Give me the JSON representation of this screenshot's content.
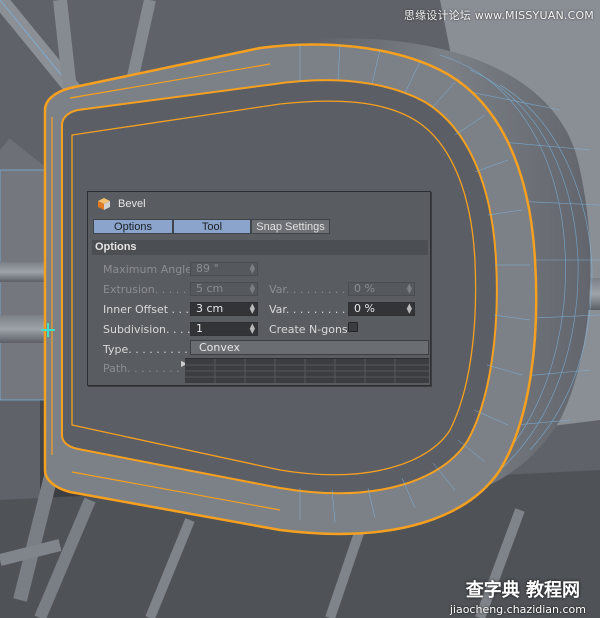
{
  "watermarks": {
    "top": "思缘设计论坛 www.MISSYUAN.COM",
    "bottom_logo": "查字典 教程网",
    "bottom_url": "jiaocheng.chazidian.com"
  },
  "icons": {
    "panel_icon": "bevel-cube-icon",
    "cursor_icon": "crosshair-plus-icon",
    "path_expander_icon": "triangle-right-icon"
  },
  "colors": {
    "highlight_edge": "#f5a021",
    "wireframe": "#7ab8e6",
    "tab_active": "#8aa4cc",
    "cursor": "#3fe0c8"
  },
  "panel": {
    "title": "Bevel",
    "tabs": [
      {
        "label": "Options",
        "active": true
      },
      {
        "label": "Tool",
        "active": true
      },
      {
        "label": "Snap Settings",
        "active": false
      }
    ],
    "section_title": "Options",
    "fields": {
      "maximum_angle": {
        "label": "Maximum Angle",
        "value": "89 °",
        "enabled": false
      },
      "extrusion": {
        "label": "Extrusion. . . . . .",
        "value": "5 cm",
        "enabled": false
      },
      "extrusion_var": {
        "label": "Var. . . . . . . . .",
        "value": "0 %",
        "enabled": false
      },
      "inner_offset": {
        "label": "Inner Offset . . .",
        "value": "3 cm",
        "enabled": true
      },
      "inner_offset_var": {
        "label": "Var. . . . . . . . .",
        "value": "0 %",
        "enabled": true
      },
      "subdivision": {
        "label": "Subdivision. . . .",
        "value": "1",
        "enabled": true
      },
      "create_ngons": {
        "label": "Create N-gons",
        "checked": false
      },
      "type": {
        "label": "Type. . . . . . . . .",
        "value": "Convex"
      },
      "path": {
        "label": "Path. . . . . . . .",
        "enabled": false
      }
    }
  }
}
